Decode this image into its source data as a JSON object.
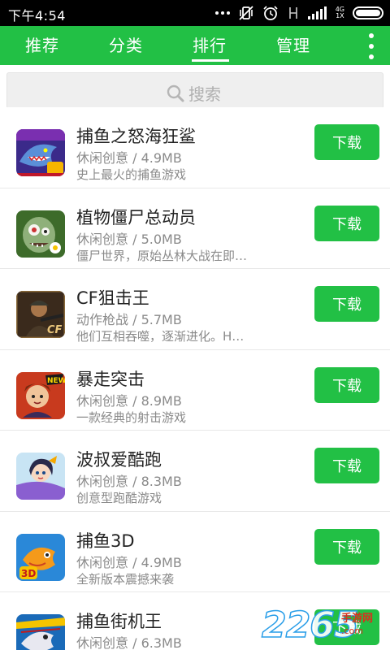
{
  "status_bar": {
    "time": "下午4:54",
    "network": "4G",
    "network_sub": "1X",
    "icons": [
      "more-dots-icon",
      "mute-vibrate-icon",
      "alarm-icon",
      "no-signal-icon",
      "signal-bars-icon",
      "battery-icon"
    ]
  },
  "nav": {
    "tabs": [
      {
        "label": "推荐",
        "active": false
      },
      {
        "label": "分类",
        "active": false
      },
      {
        "label": "排行",
        "active": true
      },
      {
        "label": "管理",
        "active": false
      }
    ],
    "overflow_icon": "vertical-dots-icon"
  },
  "search": {
    "placeholder": "搜索",
    "icon": "search-icon"
  },
  "colors": {
    "accent": "#22c045",
    "status_bar": "#000000",
    "secondary_text": "#8a8a8a"
  },
  "apps": [
    {
      "name": "捕鱼之怒海狂鲨",
      "meta": "休闲创意 / 4.9MB",
      "desc": "史上最火的捕鱼游戏",
      "button": "下载",
      "icon": "shark-game-icon"
    },
    {
      "name": "植物僵尸总动员",
      "meta": "休闲创意 / 5.0MB",
      "desc": "僵尸世界，原始丛林大战在即…",
      "button": "下载",
      "icon": "zombie-game-icon"
    },
    {
      "name": "CF狙击王",
      "meta": "动作枪战 / 5.7MB",
      "desc": "他们互相吞噬，逐渐进化。H…",
      "button": "下载",
      "icon": "cf-soldier-icon"
    },
    {
      "name": "暴走突击",
      "meta": "休闲创意 / 8.9MB",
      "desc": "一款经典的射击游戏",
      "button": "下载",
      "icon": "assault-game-icon",
      "badge": "NEW"
    },
    {
      "name": "波叔爱酷跑",
      "meta": "休闲创意 / 8.3MB",
      "desc": "创意型跑酷游戏",
      "button": "下载",
      "icon": "runner-girl-icon"
    },
    {
      "name": "捕鱼3D",
      "meta": "休闲创意 / 4.9MB",
      "desc": "全新版本震撼来袭",
      "button": "下载",
      "icon": "fish-3d-icon"
    },
    {
      "name": "捕鱼街机王",
      "meta": "休闲创意 / 6.3MB",
      "desc": "",
      "button": "下载",
      "icon": "fishing-arcade-icon"
    }
  ],
  "watermark": {
    "number": "2265",
    "text": "手游网",
    "url": ".com"
  }
}
